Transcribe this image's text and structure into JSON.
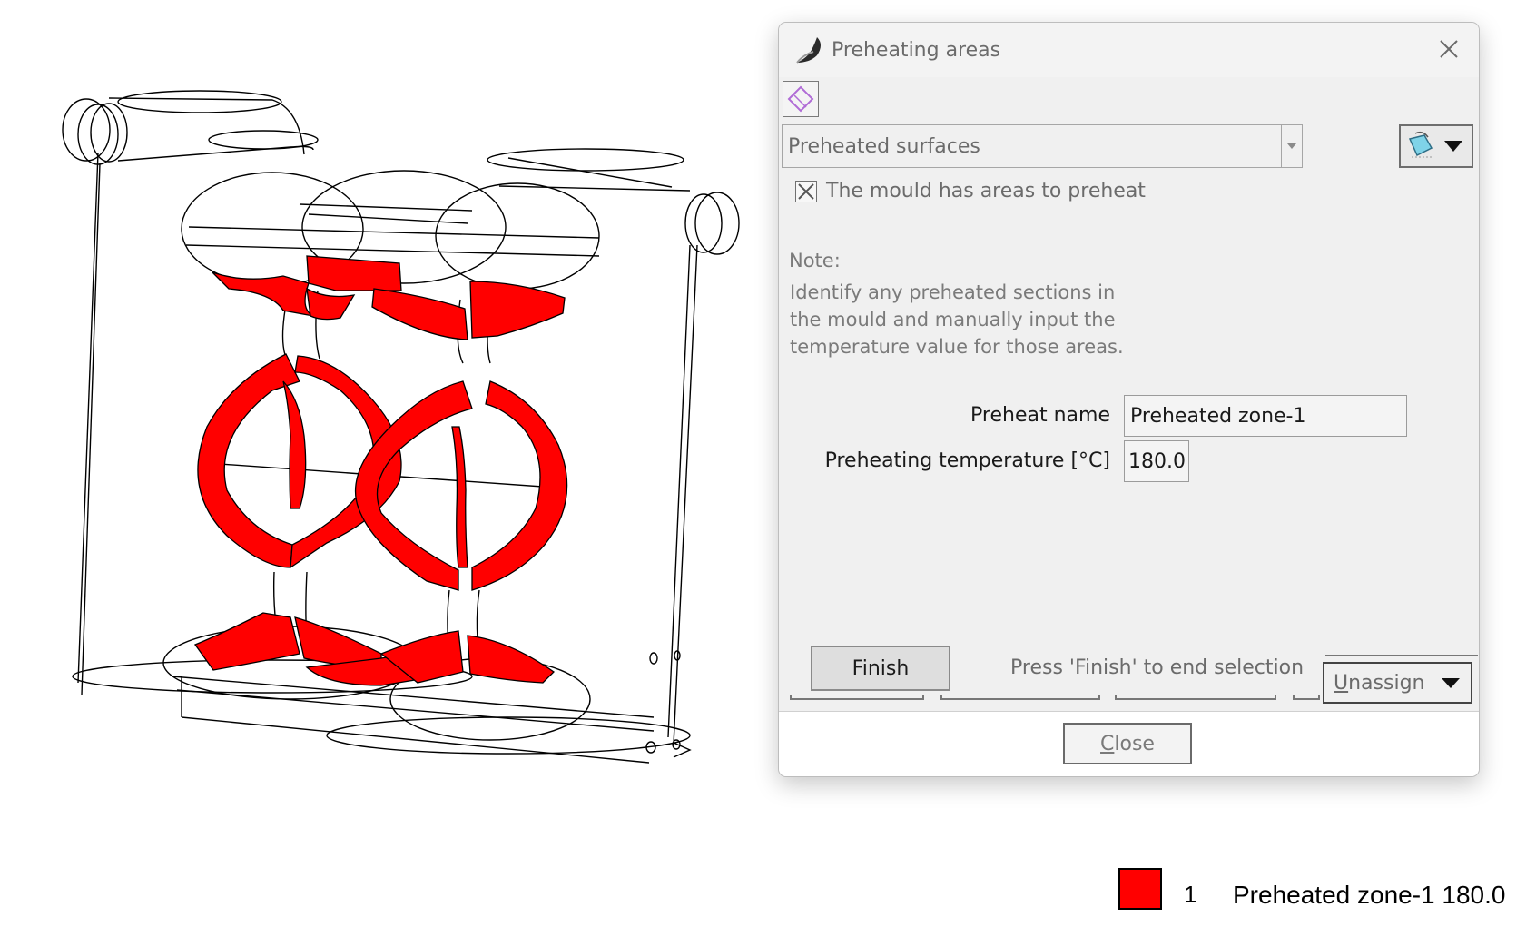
{
  "dialog": {
    "title": "Preheating areas",
    "surface_select": {
      "value": "Preheated surfaces"
    },
    "mould_checkbox": {
      "label": "The mould has areas to preheat",
      "checked": true
    },
    "note": {
      "heading": "Note:",
      "lines": [
        "Identify any preheated sections in",
        "the mould and manually input the",
        "temperature value for those areas."
      ]
    },
    "form": {
      "preheat_name_label": "Preheat name",
      "preheat_name_value": "Preheated zone-1",
      "preheat_temp_label": "Preheating temperature [°C]",
      "preheat_temp_value": "180.0"
    },
    "finish_button": "Finish",
    "finish_hint": "Press 'Finish' to end selection",
    "unassign_select": {
      "value": "Unassign",
      "mnemonic": "U",
      "rest": "nassign"
    },
    "close_button": {
      "value": "Close",
      "mnemonic": "C",
      "rest": "lose"
    }
  },
  "legend": {
    "index": "1",
    "label": "Preheated zone-1 180.0",
    "color": "#ff0000"
  },
  "colors": {
    "highlight": "#ff0000",
    "wireframe": "#000000"
  }
}
